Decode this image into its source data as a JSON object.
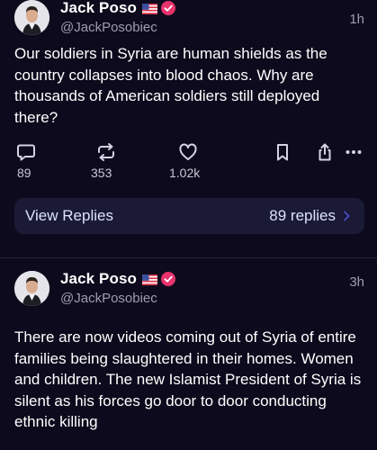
{
  "posts": [
    {
      "author": "Jack Poso",
      "handle": "@JackPosobiec",
      "time": "1h",
      "text": "Our soldiers in Syria are human shields as the country collapses into blood chaos. Why are thousands of American soldiers still deployed there?",
      "counts": {
        "replies": "89",
        "reposts": "353",
        "likes": "1.02k"
      },
      "view_replies": {
        "label": "View Replies",
        "count": "89 replies"
      }
    },
    {
      "author": "Jack Poso",
      "handle": "@JackPosobiec",
      "time": "3h",
      "text": "There are now videos coming out of Syria of entire families being slaughtered in their homes. Women and children. The new Islamist President of Syria is silent as his forces go door to door conducting ethnic killing"
    }
  ],
  "icons": {
    "reply": "speech-bubble-icon",
    "repost": "repost-arrows-icon",
    "like": "heart-icon",
    "bookmark": "bookmark-icon",
    "share": "share-icon",
    "more": "more-dots-icon",
    "flag": "us-flag-icon",
    "verified": "verified-badge-icon",
    "chevron": "chevron-right-icon"
  },
  "colors": {
    "background": "#0c0a1c",
    "card": "#1b1a35",
    "muted_text": "#9e9cb0",
    "verified": "#e8336d",
    "chevron": "#4b4cc4"
  }
}
